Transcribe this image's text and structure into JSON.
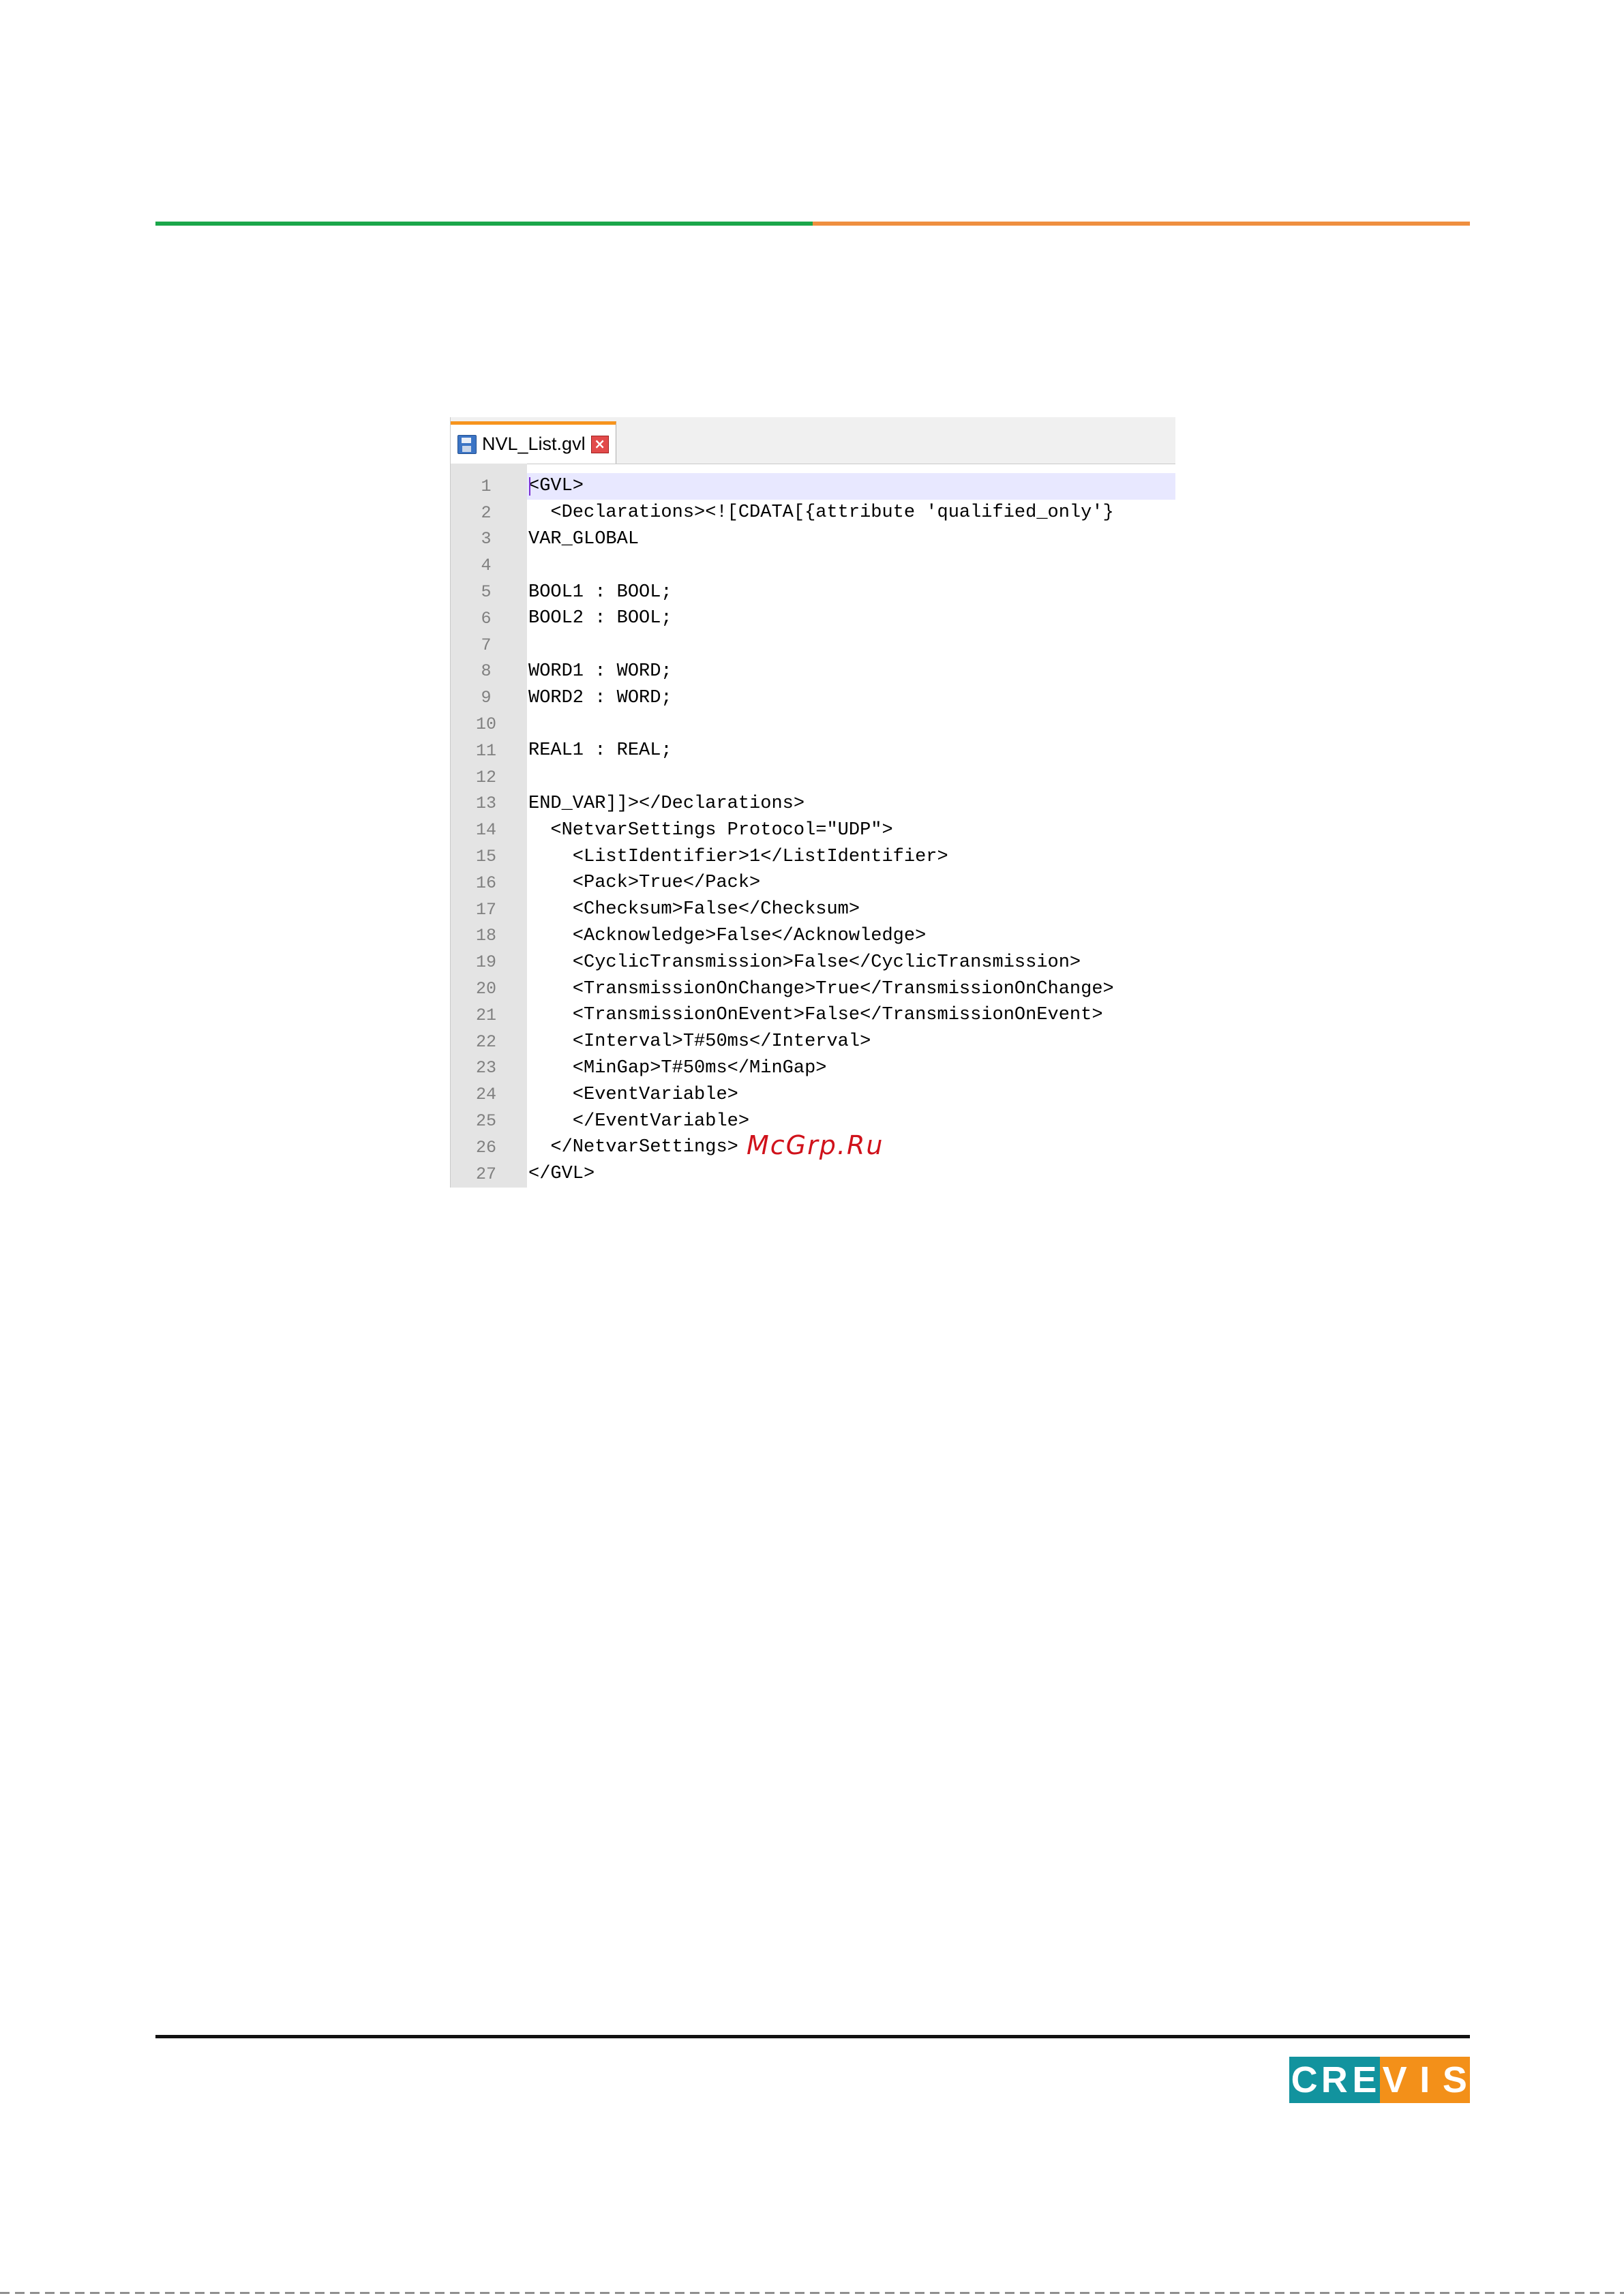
{
  "editor": {
    "tab_label": "NVL_List.gvl",
    "tab_icon": "save-icon",
    "close_icon": "close-icon",
    "lines": [
      {
        "n": "1",
        "text": "<GVL>"
      },
      {
        "n": "2",
        "text": "  <Declarations><![CDATA[{attribute 'qualified_only'}"
      },
      {
        "n": "3",
        "text": "VAR_GLOBAL"
      },
      {
        "n": "4",
        "text": ""
      },
      {
        "n": "5",
        "text": "BOOL1 : BOOL;"
      },
      {
        "n": "6",
        "text": "BOOL2 : BOOL;"
      },
      {
        "n": "7",
        "text": ""
      },
      {
        "n": "8",
        "text": "WORD1 : WORD;"
      },
      {
        "n": "9",
        "text": "WORD2 : WORD;"
      },
      {
        "n": "10",
        "text": ""
      },
      {
        "n": "11",
        "text": "REAL1 : REAL;"
      },
      {
        "n": "12",
        "text": ""
      },
      {
        "n": "13",
        "text": "END_VAR]]></Declarations>"
      },
      {
        "n": "14",
        "text": "  <NetvarSettings Protocol=\"UDP\">"
      },
      {
        "n": "15",
        "text": "    <ListIdentifier>1</ListIdentifier>"
      },
      {
        "n": "16",
        "text": "    <Pack>True</Pack>"
      },
      {
        "n": "17",
        "text": "    <Checksum>False</Checksum>"
      },
      {
        "n": "18",
        "text": "    <Acknowledge>False</Acknowledge>"
      },
      {
        "n": "19",
        "text": "    <CyclicTransmission>False</CyclicTransmission>"
      },
      {
        "n": "20",
        "text": "    <TransmissionOnChange>True</TransmissionOnChange>"
      },
      {
        "n": "21",
        "text": "    <TransmissionOnEvent>False</TransmissionOnEvent>"
      },
      {
        "n": "22",
        "text": "    <Interval>T#50ms</Interval>"
      },
      {
        "n": "23",
        "text": "    <MinGap>T#50ms</MinGap>"
      },
      {
        "n": "24",
        "text": "    <EventVariable>"
      },
      {
        "n": "25",
        "text": "    </EventVariable>"
      },
      {
        "n": "26",
        "text": "  </NetvarSettings>"
      },
      {
        "n": "27",
        "text": "</GVL>"
      }
    ]
  },
  "watermark": "McGrp.Ru",
  "logo": {
    "letters": [
      "C",
      "R",
      "E",
      "V",
      "I",
      "S"
    ],
    "colors": {
      "teal": "#12939e",
      "orange": "#f39019"
    }
  },
  "colors": {
    "rule_green": "#1aa64a",
    "rule_orange": "#ef8f3f",
    "tab_accent": "#f7941d",
    "current_line": "#e8e8ff"
  }
}
